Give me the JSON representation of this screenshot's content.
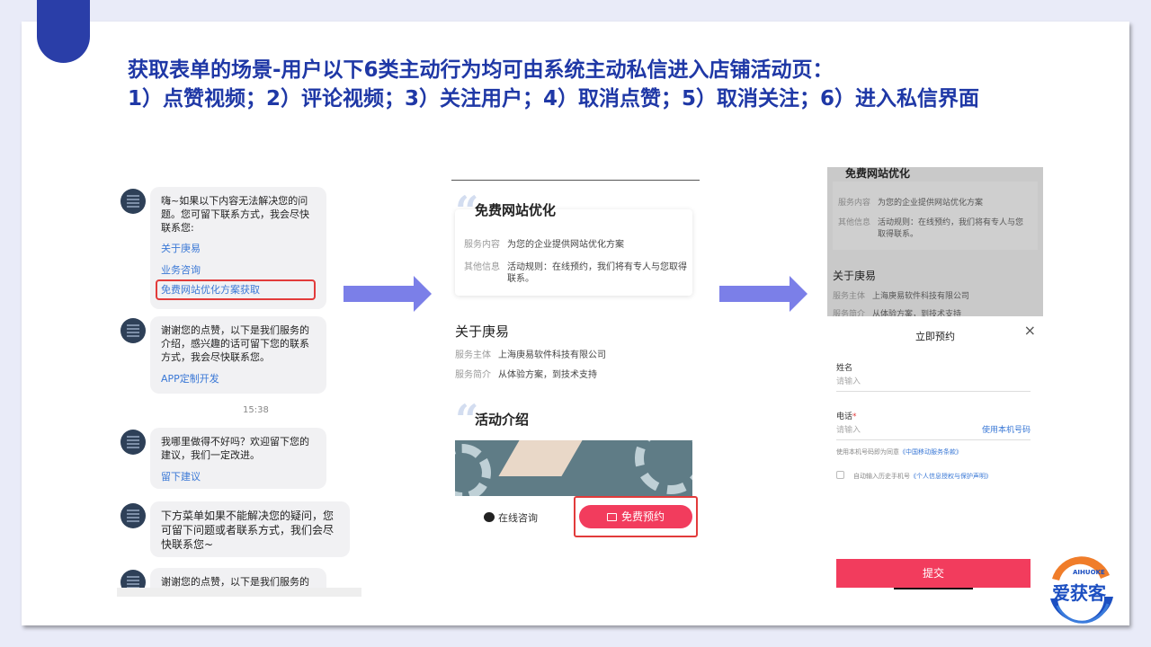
{
  "title": {
    "line1": "获取表单的场景-用户以下6类主动行为均可由系统主动私信进入店铺活动页：",
    "line2": "1）点赞视频；2）评论视频；3）关注用户；4）取消点赞；5）取消关注；6）进入私信界面"
  },
  "chat": {
    "msg1": {
      "text": "嗨~如果以下内容无法解决您的问题。您可留下联系方式，我会尽快联系您:",
      "link1": "关于庚易",
      "link2": "业务咨询",
      "link3": "免费网站优化方案获取"
    },
    "msg2": {
      "text": "谢谢您的点赞，以下是我们服务的介绍，感兴趣的话可留下您的联系方式，我会尽快联系您。",
      "link": "APP定制开发"
    },
    "time": "15:38",
    "msg3": {
      "text": "我哪里做得不好吗？欢迎留下您的建议，我们一定改进。",
      "link": "留下建议"
    },
    "msg4": {
      "text": "下方菜单如果不能解决您的疑问，您可留下问题或者联系方式，我们会尽快联系您~"
    },
    "msg5": {
      "text": "谢谢您的点赞，以下是我们服务的"
    }
  },
  "activity": {
    "heading": "免费网站优化",
    "service_content_label": "服务内容",
    "service_content": "为您的企业提供网站优化方案",
    "other_info_label": "其他信息",
    "other_info": "活动规则：在线预约，我们将有专人与您取得联系。",
    "about_heading": "关于庚易",
    "subject_label": "服务主体",
    "subject": "上海庚易软件科技有限公司",
    "intro_label": "服务简介",
    "intro": "从体验方案，到技术支持",
    "activity_heading": "活动介绍",
    "consult_label": "在线咨询",
    "reserve_label": "免费预约"
  },
  "form": {
    "bg_heading": "免费网站优化",
    "bg_service_label": "服务内容",
    "bg_service": "为您的企业提供网站优化方案",
    "bg_other_label": "其他信息",
    "bg_other": "活动规则：在线预约，我们将有专人与您取得联系。",
    "bg_about": "关于庚易",
    "bg_subject_label": "服务主体",
    "bg_subject": "上海庚易软件科技有限公司",
    "bg_intro_label": "服务简介",
    "bg_intro": "从体验方案，到技术支持",
    "title": "立即预约",
    "close": "×",
    "name_label": "姓名",
    "name_placeholder": "请输入",
    "phone_label": "电话",
    "phone_star": "*",
    "phone_placeholder": "请输入",
    "use_phone": "使用本机号码",
    "agree_text": "使用本机号码即为同意",
    "agree_link": "《中国移动服务条款》",
    "auto_text": "自动输入历史手机号",
    "auto_link": "《个人信息授权与保护声明》",
    "submit": "提交"
  },
  "logo": {
    "en": "AIHUOKE",
    "cn": "爱获客"
  },
  "colors": {
    "title": "#1f38a6",
    "accent": "#2a3ea8",
    "arrow": "#7b7fe8",
    "highlight": "#e23b3b",
    "button": "#f23c5d"
  }
}
